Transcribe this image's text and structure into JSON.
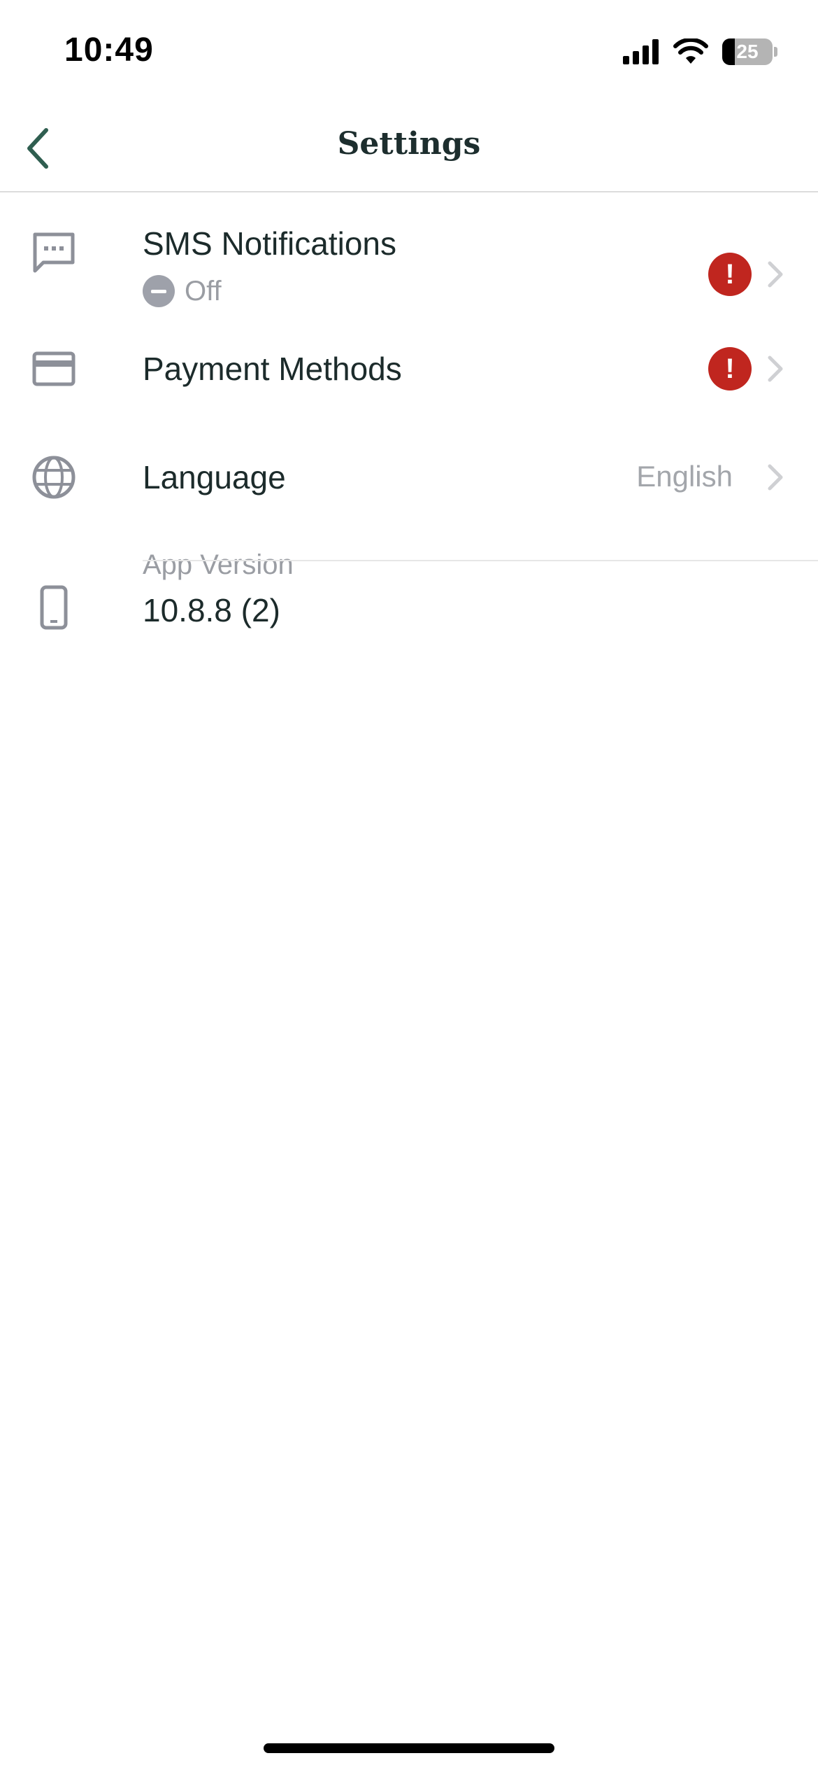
{
  "status_bar": {
    "time": "10:49",
    "battery_level": "25",
    "icons": [
      "cellular-signal-icon",
      "wifi-icon",
      "battery-icon"
    ]
  },
  "nav": {
    "title": "Settings",
    "back_icon": "chevron-left-icon",
    "accent_color": "#2f5e50"
  },
  "settings": {
    "sms": {
      "title": "SMS Notifications",
      "status": "Off",
      "icon": "message-icon",
      "alert_glyph": "!"
    },
    "payment": {
      "title": "Payment Methods",
      "icon": "credit-card-icon",
      "alert_glyph": "!"
    },
    "language": {
      "title": "Language",
      "value": "English",
      "icon": "globe-icon"
    },
    "app_version": {
      "label": "App Version",
      "value": "10.8.8 (2)",
      "icon": "phone-icon"
    }
  },
  "colors": {
    "alert": "#c0261f",
    "icon_gray": "#8d9099",
    "muted_text": "#9a9da3"
  }
}
